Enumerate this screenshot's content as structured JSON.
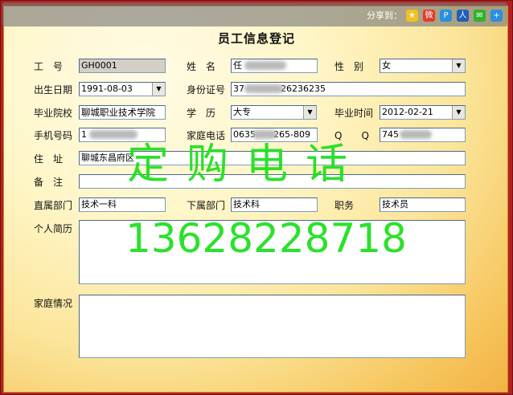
{
  "share": {
    "label": "分享到：",
    "icons": [
      "qzone-icon",
      "weibo-icon",
      "pengyou-icon",
      "renren-icon",
      "wechat-icon",
      "more-icon"
    ]
  },
  "form": {
    "title": "员工信息登记",
    "fields": {
      "emp_no": {
        "label": "工　号",
        "value": "GH0001"
      },
      "name": {
        "label": "姓　名",
        "value": "任"
      },
      "gender": {
        "label": "性　别",
        "value": "女"
      },
      "birth": {
        "label": "出生日期",
        "value": "1991-08-03"
      },
      "id_card": {
        "label": "身份证号",
        "value_prefix": "37",
        "value_suffix": "26236235"
      },
      "school": {
        "label": "毕业院校",
        "value": "聊城职业技术学院"
      },
      "education": {
        "label": "学　历",
        "value": "大专"
      },
      "grad_time": {
        "label": "毕业时间",
        "value": "2012-02-21"
      },
      "mobile": {
        "label": "手机号码",
        "value": "1"
      },
      "home_phone": {
        "label": "家庭电话",
        "value_prefix": "0635",
        "value_suffix": "265-809"
      },
      "qq": {
        "label": "Q　　Q",
        "value": "745"
      },
      "address": {
        "label": "住　址",
        "value": "聊城东昌府区"
      },
      "remark": {
        "label": "备　注",
        "value": ""
      },
      "dept_direct": {
        "label": "直属部门",
        "value": "技术一科"
      },
      "dept_sub": {
        "label": "下属部门",
        "value": "技术科"
      },
      "position": {
        "label": "职务",
        "value": "技术员"
      },
      "resume": {
        "label": "个人简历",
        "value": ""
      },
      "family": {
        "label": "家庭情况",
        "value": ""
      }
    }
  },
  "watermark": {
    "line1": "定购电话",
    "line2": "13628228718"
  },
  "colors": {
    "watermark": "#20e020",
    "frame": "#b32020"
  }
}
